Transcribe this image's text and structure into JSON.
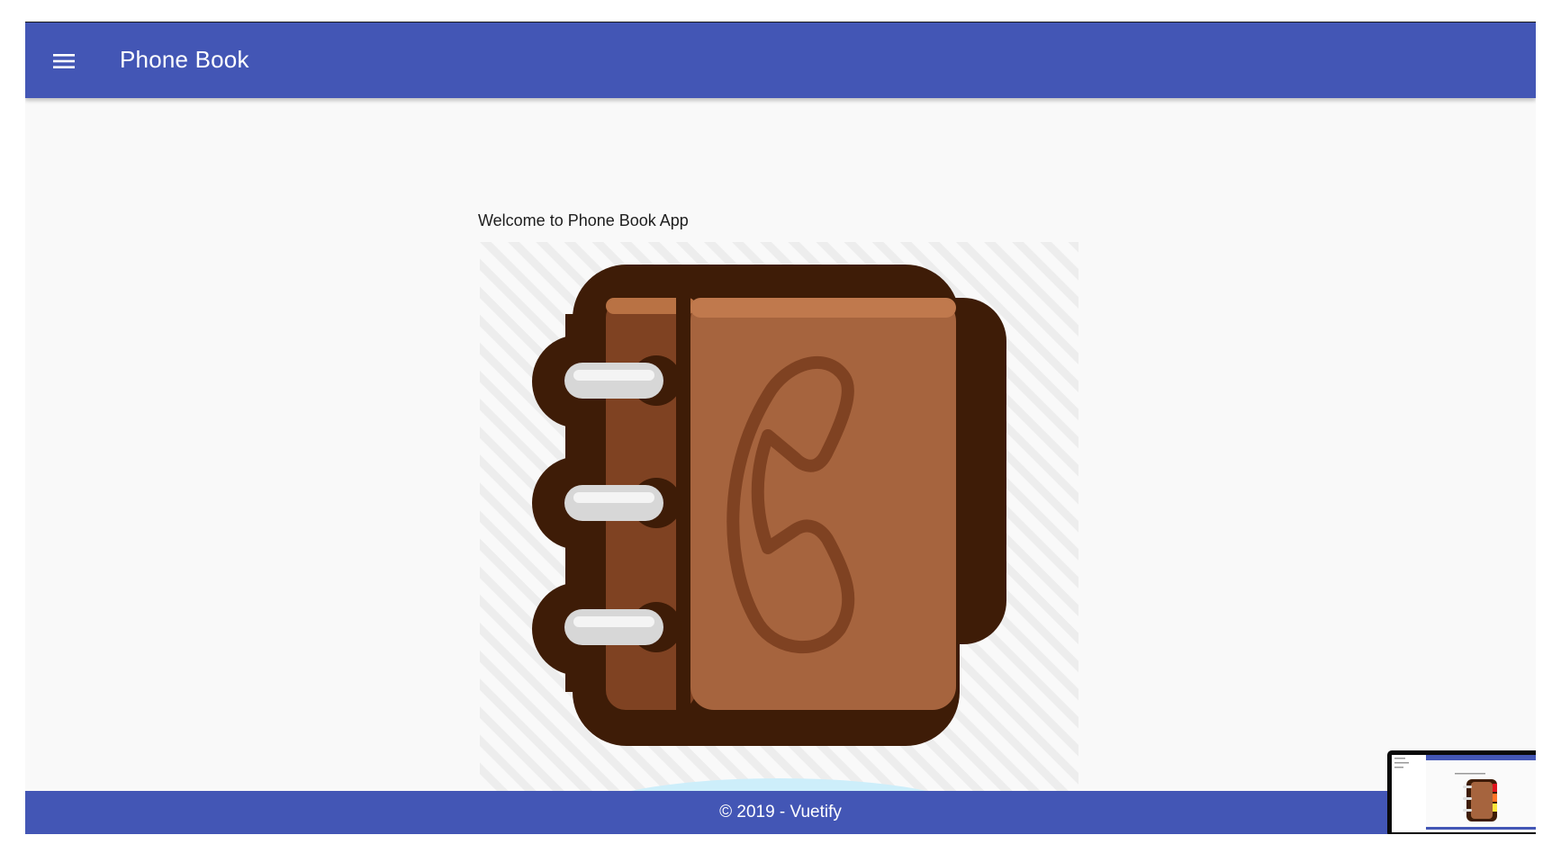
{
  "toolbar": {
    "title": "Phone Book",
    "menu_icon": "menu-icon"
  },
  "main": {
    "welcome_text": "Welcome to Phone Book App",
    "hero_image": "phone-book-illustration"
  },
  "footer": {
    "text": "© 2019 - Vuetify"
  },
  "thumbnail": {
    "label": "screen-preview"
  },
  "colors": {
    "primary": "#4356b5",
    "background": "#f9f9f9",
    "book_cover": "#a6643e",
    "book_outline": "#3e1c07",
    "tab_red": "#e0141d",
    "tab_orange": "#ff7326",
    "tab_yellow": "#fbe63b"
  }
}
